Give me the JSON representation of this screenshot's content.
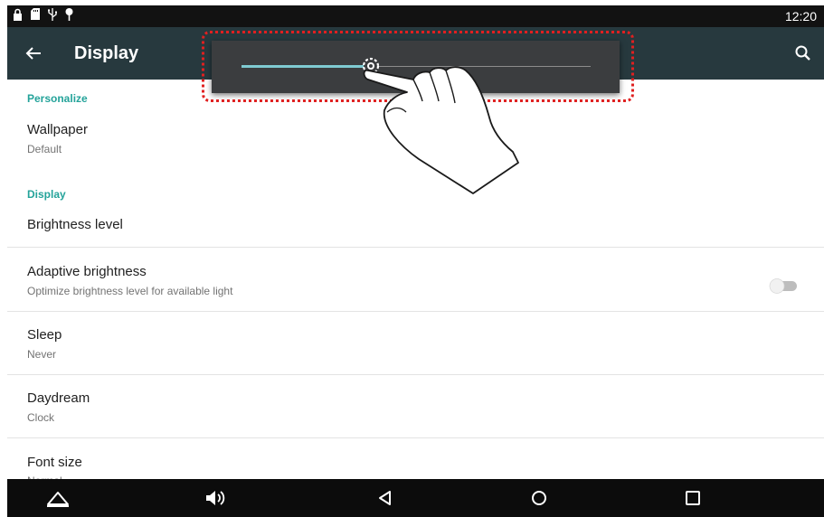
{
  "status_bar": {
    "time": "12:20",
    "icons": [
      "lock-icon",
      "sd-card-icon",
      "usb-icon",
      "location-pin-icon"
    ]
  },
  "app_bar": {
    "title": "Display",
    "back_icon": "arrow-left-icon",
    "search_icon": "search-icon"
  },
  "brightness_popup": {
    "level": 0.37,
    "thumb_icon": "gear-icon",
    "accent": "#7fcbd2"
  },
  "settings": {
    "personalize_header": "Personalize",
    "wallpaper": {
      "title": "Wallpaper",
      "summary": "Default"
    },
    "display_header": "Display",
    "brightness_level": {
      "title": "Brightness level"
    },
    "adaptive_brightness": {
      "title": "Adaptive brightness",
      "summary": "Optimize brightness level for available light",
      "enabled": false
    },
    "sleep": {
      "title": "Sleep",
      "summary": "Never"
    },
    "daydream": {
      "title": "Daydream",
      "summary": "Clock"
    },
    "font_size": {
      "title": "Font size",
      "summary": "Normal"
    }
  },
  "nav_bar": {
    "buttons": [
      "home-triangle-icon",
      "volume-icon",
      "back-icon",
      "home-circle-icon",
      "recents-square-icon"
    ]
  },
  "colors": {
    "app_bar": "#27393e",
    "section_header": "#24a39a",
    "status_bar": "#121212",
    "highlight": "#e02020"
  }
}
